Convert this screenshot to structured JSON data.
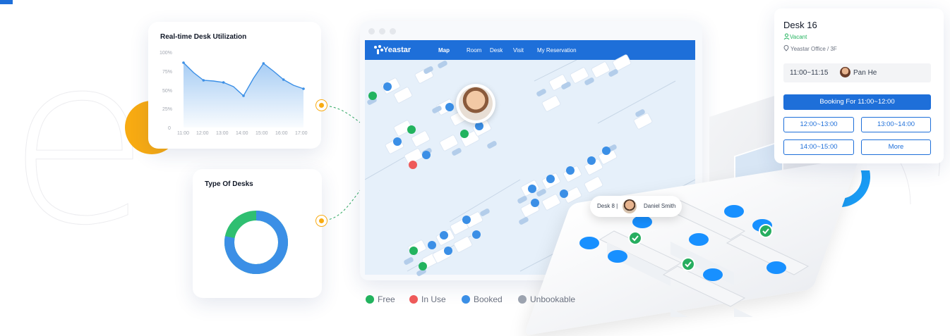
{
  "utilization_card": {
    "title": "Real-time Desk Utilization",
    "y_ticks": [
      "100%",
      "75%",
      "50%",
      "25%",
      "0"
    ],
    "x_ticks": [
      "11:00",
      "12:00",
      "13:00",
      "14:00",
      "15:00",
      "16:00",
      "17:00"
    ]
  },
  "chart_data": {
    "type": "area",
    "title": "Real-time Desk Utilization",
    "x": [
      "11:00",
      "11:30",
      "12:00",
      "12:30",
      "13:00",
      "13:30",
      "14:00",
      "14:30",
      "15:00",
      "15:30",
      "16:00",
      "16:30",
      "17:00"
    ],
    "values": [
      92,
      78,
      67,
      66,
      64,
      58,
      45,
      70,
      91,
      80,
      68,
      60,
      55
    ],
    "ylim": [
      0,
      100
    ],
    "ylabel": "",
    "xlabel": "",
    "color": "#3b8fe6"
  },
  "desk_types_card": {
    "title": "Type Of Desks",
    "donut": {
      "primary_color": "#3b8fe6",
      "secondary_color": "#2fbf71",
      "primary_fraction": 0.78
    }
  },
  "map_window": {
    "brand": "Yeastar",
    "nav": [
      "Map",
      "Room",
      "Desk",
      "Visit",
      "My Reservation"
    ],
    "active_nav": "Map",
    "nav_color": "#1e6fd9"
  },
  "desk_popup": {
    "label": "Desk 8 |",
    "person": "Daniel Smith"
  },
  "booking_card": {
    "desk_name": "Desk 16",
    "status": "Vacant",
    "location": "Yeastar Office / 3F",
    "current_time": "11:00~11:15",
    "current_user": "Pan He",
    "primary_action": "Booking For 11:00~12:00",
    "slots": [
      "12:00~13:00",
      "13:00~14:00",
      "14:00~15:00",
      "More"
    ]
  },
  "legend": [
    {
      "label": "Free",
      "color": "#22b35e"
    },
    {
      "label": "In Use",
      "color": "#ee5a5a"
    },
    {
      "label": "Booked",
      "color": "#3b8fe6"
    },
    {
      "label": "Unbookable",
      "color": "#9ca3af"
    }
  ],
  "icons": [
    "pin-icon",
    "vacant-icon",
    "yeastar-logo-icon",
    "checkmark-icon",
    "avatar-icon"
  ]
}
